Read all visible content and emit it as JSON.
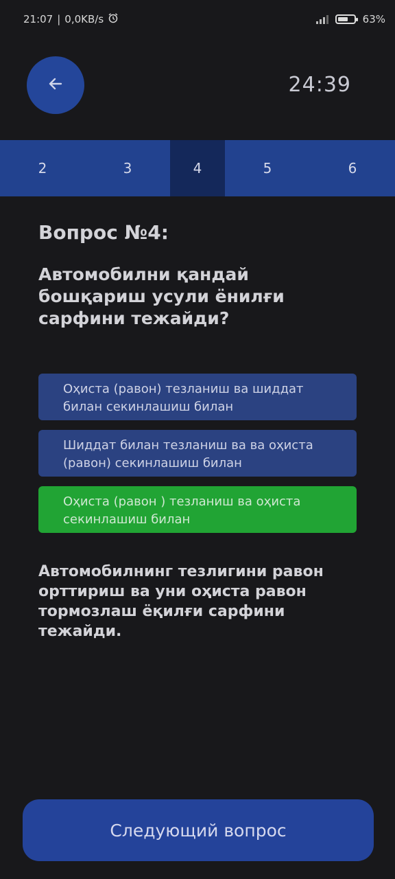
{
  "status": {
    "time": "21:07",
    "net_speed": "0,0KB/s",
    "battery": "63%",
    "battery_level": 0.63
  },
  "header": {
    "back_icon": "arrow-left-icon",
    "timer": "24:39"
  },
  "question_nav": {
    "items": [
      "2",
      "3",
      "4",
      "5",
      "6"
    ],
    "active": "4"
  },
  "question": {
    "title": "Вопрос №4:",
    "text": "Автомобилни қандай бошқариш усули ёнилғи сарфини тежайди?"
  },
  "answers": [
    {
      "text": "Оҳиста (равон) тезланиш ва шиддат билан секинлашиш билан",
      "state": "default"
    },
    {
      "text": "Шиддат билан тезланиш ва ва оҳиста (равон) секинлашиш билан",
      "state": "default"
    },
    {
      "text": "Оҳиста (равон ) тезланиш ва оҳиста секинлашиш билан",
      "state": "correct"
    }
  ],
  "explanation": "Автомобилнинг тезлигини равон орттириш ва уни оҳиста равон тормозлаш ёқилғи сарфини тежайди.",
  "next_button": {
    "label": "Следующий вопрос"
  },
  "colors": {
    "background": "#18181b",
    "accent": "#24439a",
    "correct": "#21a434"
  }
}
